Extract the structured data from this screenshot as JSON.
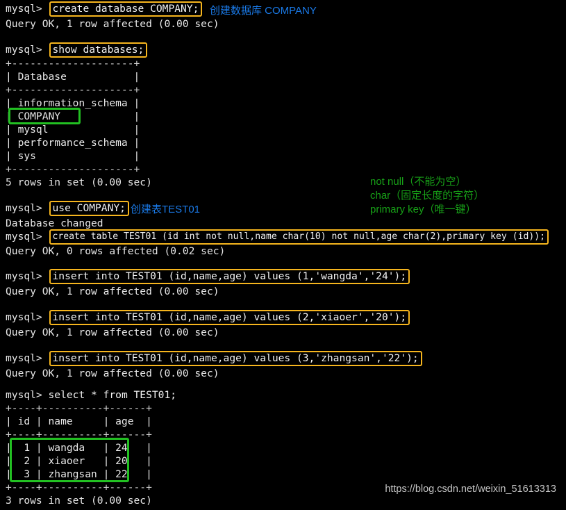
{
  "terminal": {
    "prompt": "mysql> ",
    "watermark": "https://blog.csdn.net/weixin_51613313",
    "blocks": {
      "create_db": {
        "command": "create database COMPANY;",
        "result": "Query OK, 1 row affected (0.00 sec)"
      },
      "show_databases": {
        "command": "show databases;",
        "sep_top": "+--------------------+",
        "header": "| Database           |",
        "sep_mid": "+--------------------+",
        "rows": [
          "| information_schema |",
          "| COMPANY            |",
          "| mysql              |",
          "| performance_schema |",
          "| sys                |"
        ],
        "sep_bottom": "+--------------------+",
        "footer": "5 rows in set (0.00 sec)"
      },
      "use_db": {
        "command": "use COMPANY;",
        "result": "Database changed"
      },
      "create_table": {
        "command": "create table TEST01 (id int not null,name char(10) not null,age char(2),primary key (id));",
        "result": "Query OK, 0 rows affected (0.02 sec)"
      },
      "insert1": {
        "command": "insert into TEST01 (id,name,age) values (1,'wangda','24');",
        "result": "Query OK, 1 row affected (0.00 sec)"
      },
      "insert2": {
        "command": "insert into TEST01 (id,name,age) values (2,'xiaoer','20');",
        "result": "Query OK, 1 row affected (0.00 sec)"
      },
      "insert3": {
        "command": "insert into TEST01 (id,name,age) values (3,'zhangsan','22');",
        "result": "Query OK, 1 row affected (0.00 sec)"
      },
      "select_all": {
        "command": "select * from TEST01;",
        "sep_top": "+----+----------+------+",
        "header": "| id | name     | age  |",
        "sep_mid": "+----+----------+------+",
        "rows": [
          "|  1 | wangda   | 24   |",
          "|  2 | xiaoer   | 20   |",
          "|  3 | zhangsan | 22   |"
        ],
        "sep_bottom": "+----+----------+------+",
        "footer": "3 rows in set (0.00 sec)"
      }
    }
  },
  "annotations": {
    "create_db_note": "创建数据库 COMPANY",
    "create_table_note": "创建表TEST01",
    "keyword_notes": [
      "not null（不能为空）",
      "char（固定长度的字符）",
      "primary key（唯一键）"
    ]
  },
  "colors": {
    "background": "#000000",
    "text": "#e8e8e8",
    "highlight_orange": "#f6b51e",
    "highlight_green": "#22c022",
    "annotation_blue": "#1a7ae8",
    "annotation_green": "#17a017"
  }
}
